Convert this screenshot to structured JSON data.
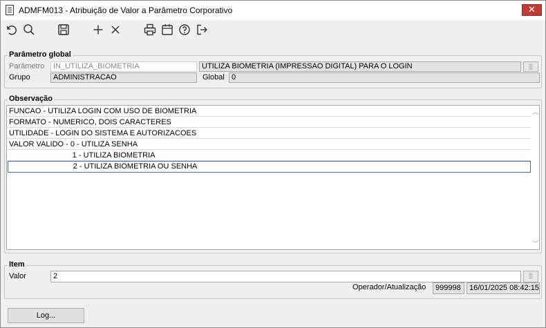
{
  "window": {
    "title": "ADMFM013 - Atribuição de Valor a Parâmetro Corporativo",
    "close_label": "✕"
  },
  "toolbar": {
    "icons": [
      "undo-icon",
      "search-icon",
      "save-icon",
      "add-icon",
      "delete-icon",
      "print-icon",
      "calendar-icon",
      "help-icon",
      "exit-icon"
    ]
  },
  "parametro_global": {
    "group_title": "Parâmetro global",
    "parametro_label": "Parâmetro",
    "parametro_value": "IN_UTILIZA_BIOMETRIA",
    "descricao_value": "UTILIZA BIOMETRIA (IMPRESSAO DIGITAL) PARA O LOGIN",
    "grupo_label": "Grupo",
    "grupo_value": "ADMINISTRACAO",
    "global_label": "Global",
    "global_value": "0"
  },
  "observacao": {
    "group_title": "Observação",
    "lines": [
      "FUNCAO - UTILIZA LOGIN COM USO DE BIOMETRIA",
      "FORMATO - NUMERICO, DOIS CARACTERES",
      "UTILIDADE - LOGIN DO SISTEMA E AUTORIZACOES",
      "VALOR VALIDO - 0 - UTILIZA SENHA",
      "                              1 - UTILIZA BIOMETRIA",
      "                              2 - UTILIZA BIOMETRIA OU SENHA"
    ]
  },
  "item": {
    "group_title": "Item",
    "valor_label": "Valor",
    "valor_value": "2",
    "operador_label": "Operador/Atualização",
    "operador_value": "999998",
    "data_value": "16/01/2025 08:42:15"
  },
  "footer": {
    "log_label": "Log..."
  },
  "colors": {
    "close": "#c43b35",
    "selection_border": "#3d6aa8",
    "readonly_bg": "#e3e3e3"
  }
}
